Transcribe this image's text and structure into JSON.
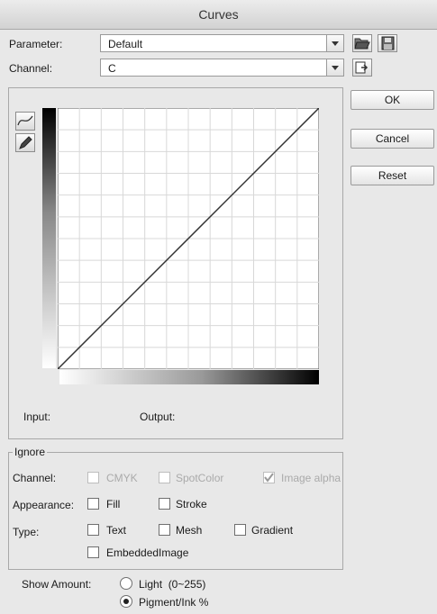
{
  "window": {
    "title": "Curves"
  },
  "parameter": {
    "label": "Parameter:",
    "value": "Default"
  },
  "channel": {
    "label": "Channel:",
    "value": "C"
  },
  "buttons": {
    "ok": "OK",
    "cancel": "Cancel",
    "reset": "Reset"
  },
  "curve": {
    "input_label": "Input:",
    "output_label": "Output:",
    "points": [
      [
        0,
        0
      ],
      [
        255,
        255
      ]
    ],
    "tools": [
      "curve-tool-icon",
      "pencil-tool-icon"
    ]
  },
  "ignore": {
    "title": "Ignore",
    "channel_label": "Channel:",
    "appearance_label": "Appearance:",
    "type_label": "Type:",
    "cmyk": {
      "label": "CMYK",
      "checked": false,
      "disabled": true
    },
    "spotcolor": {
      "label": "SpotColor",
      "checked": false,
      "disabled": true
    },
    "image_alpha": {
      "label": "Image alpha",
      "checked": true,
      "disabled": true
    },
    "fill": {
      "label": "Fill",
      "checked": false
    },
    "stroke": {
      "label": "Stroke",
      "checked": false
    },
    "text": {
      "label": "Text",
      "checked": false
    },
    "mesh": {
      "label": "Mesh",
      "checked": false
    },
    "gradient": {
      "label": "Gradient",
      "checked": false
    },
    "embedded_image": {
      "label": "EmbeddedImage",
      "checked": false
    }
  },
  "show_amount": {
    "label": "Show Amount:",
    "light": {
      "label": "Light  (0~255)",
      "selected": false
    },
    "pigment": {
      "label": "Pigment/Ink %",
      "selected": true
    }
  }
}
